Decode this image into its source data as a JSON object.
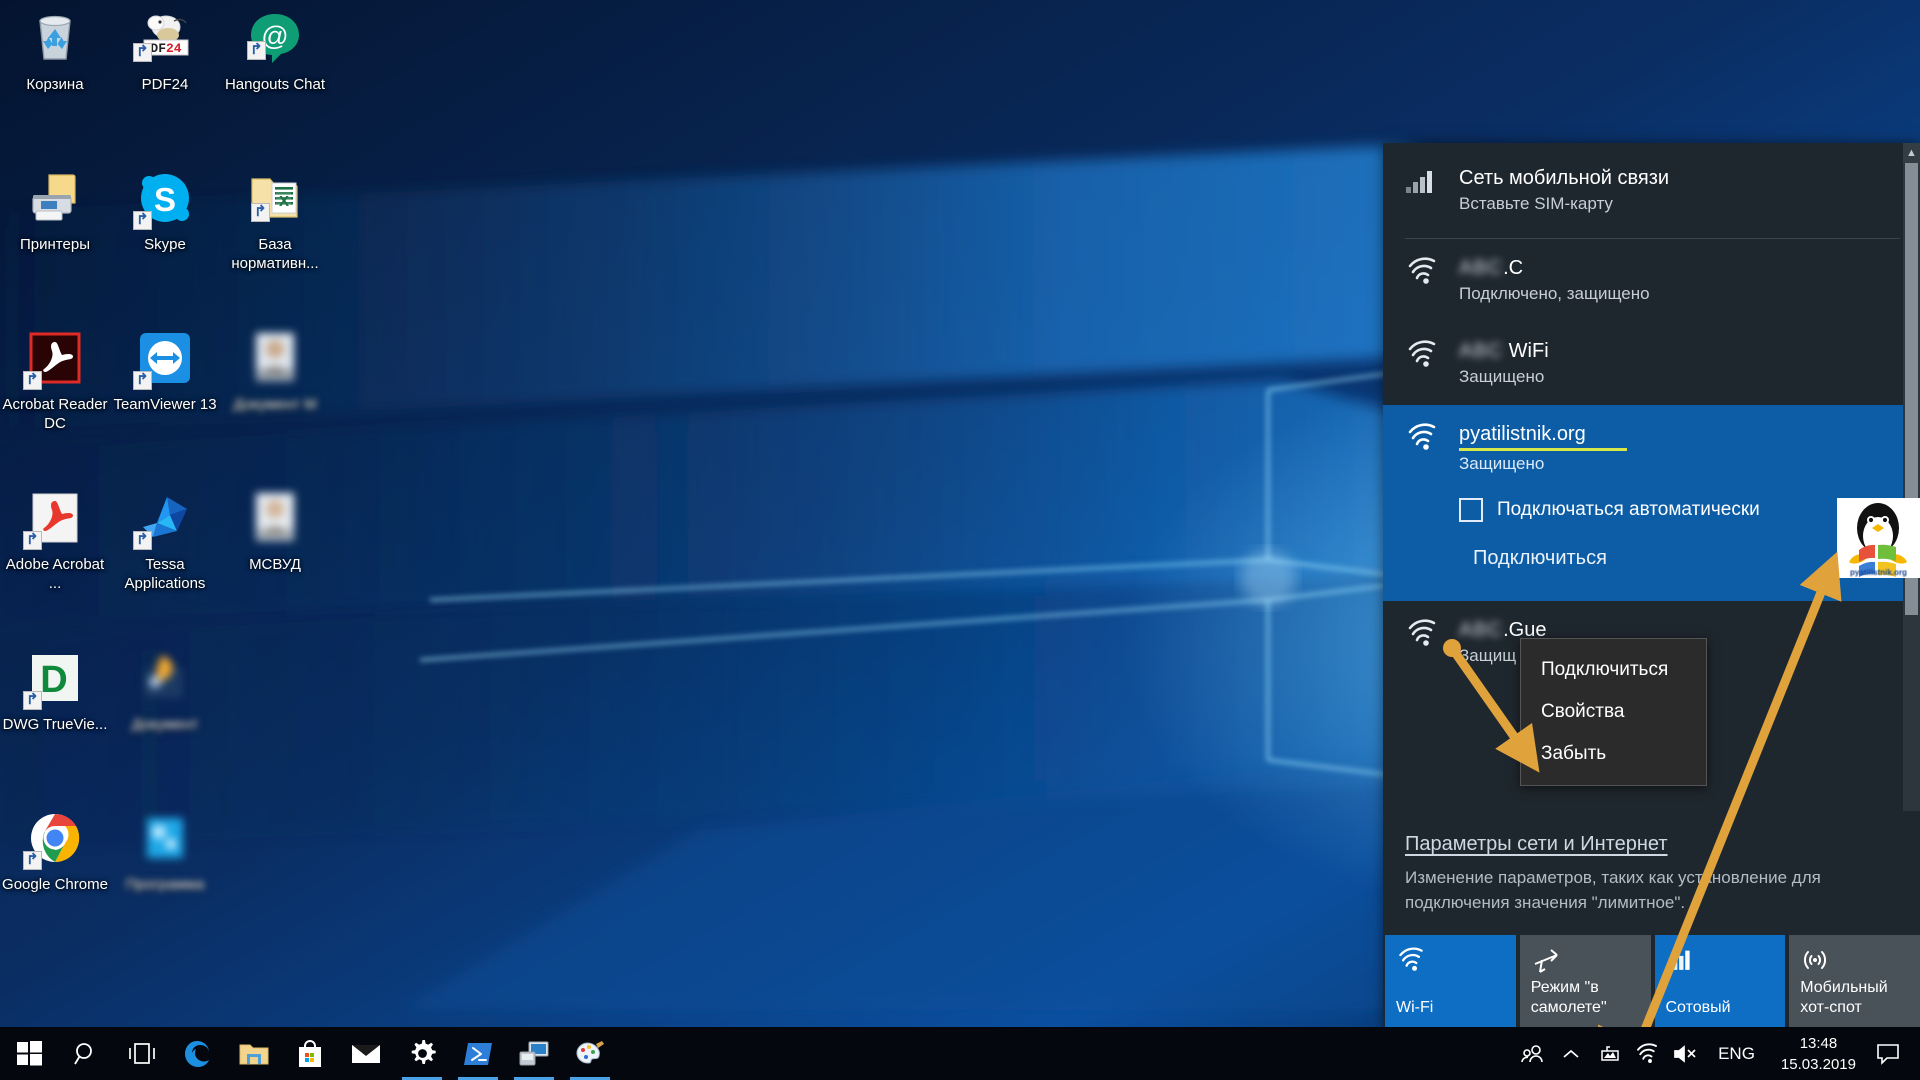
{
  "desktop": {
    "icons": [
      {
        "label": "Корзина",
        "icon": "recycle-bin-icon",
        "shortcut": false,
        "blurred": false
      },
      {
        "label": "Принтеры",
        "icon": "printers-folder-icon",
        "shortcut": false,
        "blurred": false
      },
      {
        "label": "Acrobat Reader DC",
        "icon": "acrobat-reader-icon",
        "shortcut": true,
        "blurred": false
      },
      {
        "label": "Adobe Acrobat ...",
        "icon": "adobe-acrobat-icon",
        "shortcut": true,
        "blurred": false
      },
      {
        "label": "DWG TrueVie...",
        "icon": "dwg-trueview-icon",
        "shortcut": true,
        "blurred": false
      },
      {
        "label": "Google Chrome",
        "icon": "google-chrome-icon",
        "shortcut": true,
        "blurred": false
      },
      {
        "label": "PDF24",
        "icon": "pdf24-icon",
        "shortcut": true,
        "blurred": false
      },
      {
        "label": "Skype",
        "icon": "skype-icon",
        "shortcut": true,
        "blurred": false
      },
      {
        "label": "TeamViewer 13",
        "icon": "teamviewer-icon",
        "shortcut": true,
        "blurred": false
      },
      {
        "label": "Tessa Applications",
        "icon": "tessa-icon",
        "shortcut": true,
        "blurred": false
      },
      {
        "label": "",
        "icon": "blurred-shortcut-icon",
        "shortcut": true,
        "blurred": true
      },
      {
        "label": "",
        "icon": "blurred-shortcut-icon",
        "shortcut": true,
        "blurred": true
      },
      {
        "label": "Hangouts Chat",
        "icon": "hangouts-chat-icon",
        "shortcut": true,
        "blurred": false
      },
      {
        "label": "База нормативн...",
        "icon": "excel-folder-icon",
        "shortcut": true,
        "blurred": false
      },
      {
        "label": "",
        "icon": "blurred-person-icon",
        "shortcut": false,
        "blurred": true
      },
      {
        "label": "МСВУД",
        "icon": "blurred-person-icon",
        "shortcut": false,
        "blurred": true
      },
      {
        "label": "",
        "icon": "blurred-shortcut-icon",
        "shortcut": false,
        "blurred": true
      },
      {
        "label": "",
        "icon": "blurred-shortcut-icon",
        "shortcut": false,
        "blurred": true
      }
    ]
  },
  "network_flyout": {
    "mobile_network": {
      "name": "Сеть мобильной связи",
      "status": "Вставьте SIM-карту",
      "icon": "cellular-signal-icon"
    },
    "networks": [
      {
        "blurred_prefix": "\u0000\u0000\u0000",
        "name": ".C",
        "status": "Подключено, защищено",
        "icon": "wifi-icon",
        "selected": false
      },
      {
        "blurred_prefix": "\u0000\u0000\u0000",
        "name": " WiFi",
        "status": "Защищено",
        "icon": "wifi-icon",
        "selected": false
      },
      {
        "blurred_prefix": "",
        "name": "pyatilistnik.org",
        "status": "Защищено",
        "icon": "wifi-icon",
        "selected": true,
        "auto_connect_label": "Подключаться автоматически",
        "auto_connect_checked": false,
        "connect_button": "Подключиться"
      },
      {
        "blurred_prefix": "\u0000\u0000\u0000",
        "name": ".Gue",
        "status": "Защищ",
        "icon": "wifi-icon",
        "selected": false
      }
    ],
    "settings_link": "Параметры сети и Интернет",
    "settings_description": "Изменение параметров, таких как установление для подключения значения \"лимитное\".",
    "quick_tiles": [
      {
        "label": "Wi-Fi",
        "icon": "wifi-icon",
        "on": true
      },
      {
        "label": "Режим \"в самолете\"",
        "icon": "airplane-icon",
        "on": false
      },
      {
        "label": "Сотовый",
        "icon": "cellular-signal-icon",
        "on": true
      },
      {
        "label": "Мобильный хот-спот",
        "icon": "hotspot-icon",
        "on": false
      }
    ],
    "watermark_text": "pyatilistnik.org"
  },
  "context_menu": {
    "items": [
      {
        "label": "Подключиться"
      },
      {
        "label": "Свойства"
      },
      {
        "label": "Забыть"
      }
    ]
  },
  "taskbar": {
    "start": {
      "icon": "windows-logo-icon"
    },
    "buttons": [
      {
        "icon": "search-icon",
        "running": false
      },
      {
        "icon": "task-view-icon",
        "running": false
      },
      {
        "icon": "edge-icon",
        "running": false
      },
      {
        "icon": "file-explorer-icon",
        "running": false
      },
      {
        "icon": "microsoft-store-icon",
        "running": false
      },
      {
        "icon": "mail-icon",
        "running": false
      },
      {
        "icon": "settings-gear-icon",
        "running": true
      },
      {
        "icon": "powershell-icon",
        "running": true
      },
      {
        "icon": "remote-desktop-icon",
        "running": true
      },
      {
        "icon": "paint-icon",
        "running": true
      }
    ],
    "tray": {
      "icons": [
        {
          "icon": "people-icon"
        },
        {
          "icon": "chevron-up-icon"
        },
        {
          "icon": "battery-icon"
        },
        {
          "icon": "wifi-icon"
        },
        {
          "icon": "speaker-muted-icon"
        }
      ],
      "language": "ENG",
      "time": "13:48",
      "date": "15.03.2019",
      "action_center_icon": "notification-icon"
    }
  },
  "colors": {
    "accent_blue": "#0d6ec4",
    "selected_blue": "#0d5da6",
    "flyout_bg": "#1f272e",
    "tile_off": "#4a5259",
    "annotation_orange": "#e0a33c",
    "highlight_yellow": "#d8e84a"
  }
}
